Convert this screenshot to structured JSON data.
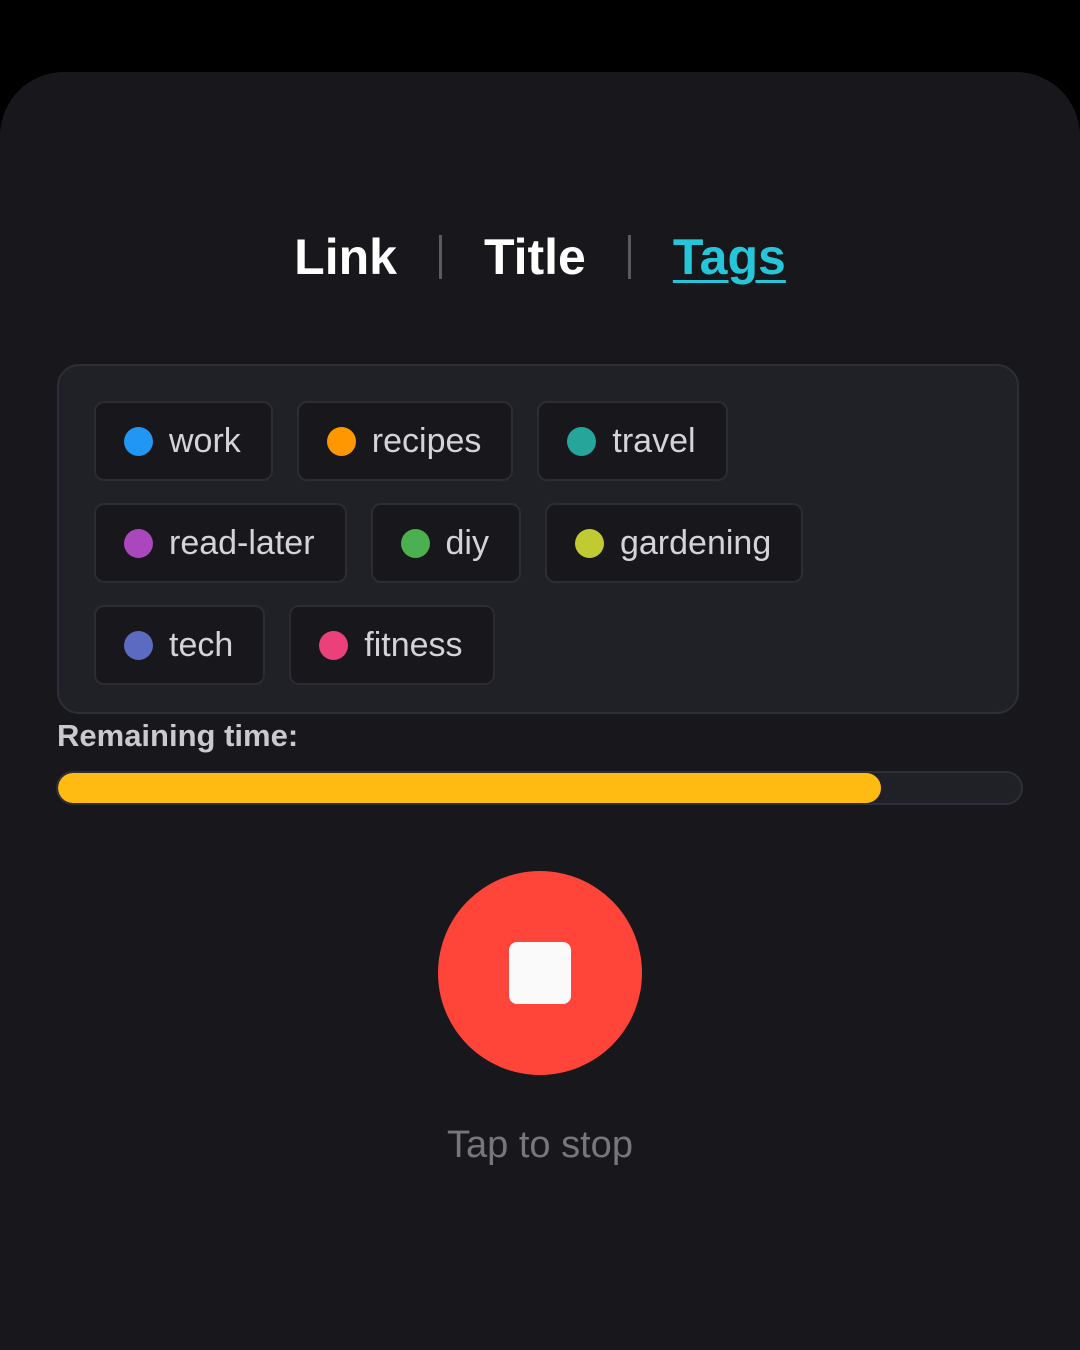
{
  "tabs": [
    {
      "label": "Link",
      "active": false
    },
    {
      "label": "Title",
      "active": false
    },
    {
      "label": "Tags",
      "active": true
    }
  ],
  "tags": [
    {
      "label": "work",
      "color": "#2196f3"
    },
    {
      "label": "recipes",
      "color": "#ff9800"
    },
    {
      "label": "travel",
      "color": "#26a69a"
    },
    {
      "label": "read-later",
      "color": "#ab47bc"
    },
    {
      "label": "diy",
      "color": "#4caf50"
    },
    {
      "label": "gardening",
      "color": "#c0ca33"
    },
    {
      "label": "tech",
      "color": "#5c6bc0"
    },
    {
      "label": "fitness",
      "color": "#ec407a"
    }
  ],
  "timer": {
    "label": "Remaining time:",
    "progress_percent": 85.5,
    "color": "#ffbb12"
  },
  "stop": {
    "icon": "stop-icon",
    "hint": "Tap to stop"
  }
}
